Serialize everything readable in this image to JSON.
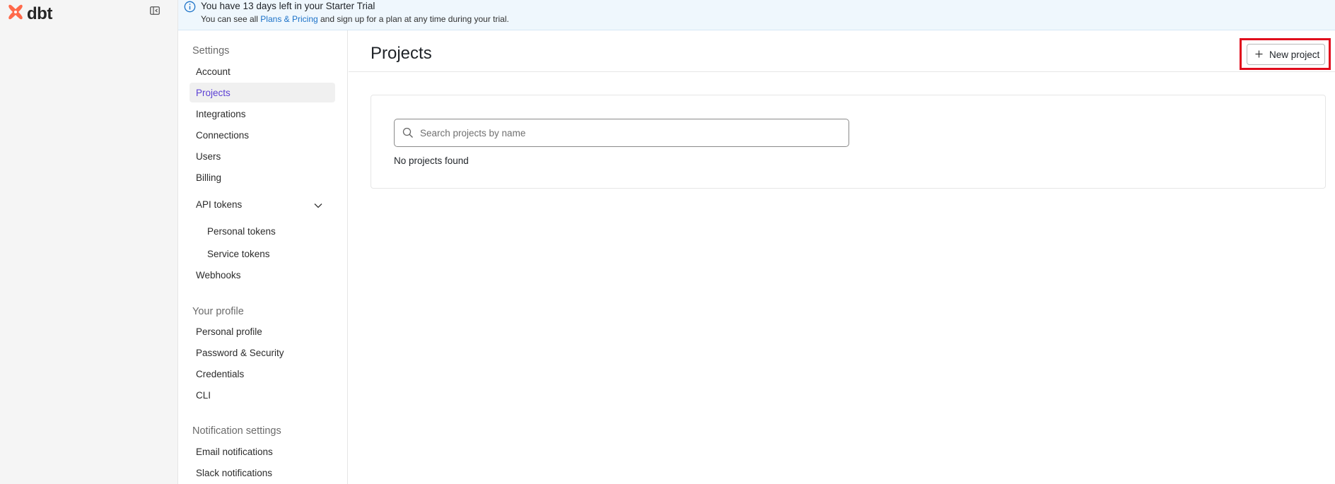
{
  "app": {
    "name": "dbt",
    "brand_color": "#FF694A"
  },
  "banner": {
    "title": "You have 13 days left in your Starter Trial",
    "sub_before": "You can see all ",
    "sub_link": "Plans & Pricing",
    "sub_after": " and sign up for a plan at any time during your trial."
  },
  "nav": {
    "settings_heading": "Settings",
    "account": "Account",
    "projects": "Projects",
    "integrations": "Integrations",
    "connections": "Connections",
    "users": "Users",
    "billing": "Billing",
    "api_tokens": "API tokens",
    "personal_tokens": "Personal tokens",
    "service_tokens": "Service tokens",
    "webhooks": "Webhooks",
    "profile_heading": "Your profile",
    "personal_profile": "Personal profile",
    "password_security": "Password & Security",
    "credentials": "Credentials",
    "cli": "CLI",
    "notifications_heading": "Notification settings",
    "email_notifications": "Email notifications",
    "slack_notifications": "Slack notifications",
    "active_item": "Projects"
  },
  "main": {
    "title": "Projects",
    "new_project_label": "New project",
    "search_placeholder": "Search projects by name",
    "search_value": "",
    "empty_text": "No projects found"
  },
  "icons": {
    "logo": "dbt-logo-icon",
    "collapse": "sidebar-collapse-icon",
    "info": "info-icon",
    "chevron": "chevron-down-icon",
    "plus": "plus-icon",
    "search": "search-icon"
  }
}
